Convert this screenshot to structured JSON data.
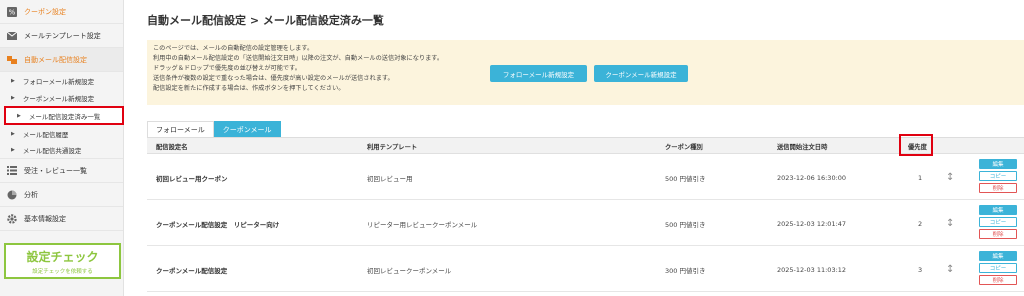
{
  "sidebar": {
    "items": [
      {
        "label": "クーポン設定",
        "icon": "percent-icon",
        "active": false
      },
      {
        "label": "メールテンプレート設定",
        "icon": "envelope-icon",
        "active": false
      },
      {
        "label": "自動メール配信設定",
        "icon": "megaphone-icon",
        "active": true
      }
    ],
    "subitems": [
      {
        "label": "フォローメール新規設定"
      },
      {
        "label": "クーポンメール新規設定"
      },
      {
        "label": "メール配信設定済み一覧"
      },
      {
        "label": "メール配信履歴"
      },
      {
        "label": "メール配信共通設定"
      }
    ],
    "items2": [
      {
        "label": "受注・レビュー一覧",
        "icon": "list-icon"
      },
      {
        "label": "分析",
        "icon": "pie-chart-icon"
      },
      {
        "label": "基本情報設定",
        "icon": "gear-icon"
      }
    ],
    "check": {
      "title": "設定チェック",
      "subtitle": "設定チェックを依頼する"
    }
  },
  "page": {
    "title": "自動メール配信設定 > メール配信設定済み一覧"
  },
  "info": {
    "lines": [
      "このページでは、メールの自動配信の設定管理をします。",
      "利用中の自動メール配信設定の「送信開始注文日時」以降の注文が、自動メールの送信対象になります。",
      "ドラッグ＆ドロップで優先度の並び替えが可能です。",
      "送信条件が複数の設定で重なった場合は、優先度が高い設定のメールが送信されます。",
      "配信設定を新たに作成する場合は、作成ボタンを押下してください。"
    ],
    "follow_button": "フォローメール新規設定",
    "coupon_button": "クーポンメール新規設定"
  },
  "tabs": [
    {
      "label": "フォローメール",
      "active": false
    },
    {
      "label": "クーポンメール",
      "active": true
    }
  ],
  "table": {
    "headers": {
      "name": "配信設定名",
      "template": "利用テンプレート",
      "coupon_type": "クーポン種別",
      "start_date": "送信開始注文日時",
      "priority": "優先度"
    },
    "rows": [
      {
        "name": "初回レビュー用クーポン",
        "template": "初回レビュー用",
        "coupon_type": "500 円値引き",
        "start_date": "2023-12-06 16:30:00",
        "priority": "1"
      },
      {
        "name": "クーポンメール配信設定　リピーター向け",
        "template": "リピーター用レビュークーポンメール",
        "coupon_type": "500 円値引き",
        "start_date": "2025-12-03 12:01:47",
        "priority": "2"
      },
      {
        "name": "クーポンメール配信設定",
        "template": "初回レビュークーポンメール",
        "coupon_type": "300 円値引き",
        "start_date": "2025-12-03 11:03:12",
        "priority": "3"
      }
    ],
    "actions": {
      "edit": "編集",
      "copy": "コピー",
      "delete": "削除"
    },
    "sort_glyph": "↕"
  },
  "colors": {
    "accent": "#3bb3d8",
    "active": "#e8801e",
    "highlight": "#e00010",
    "check": "#8dc63f",
    "info_bg": "#fcf4dd"
  }
}
